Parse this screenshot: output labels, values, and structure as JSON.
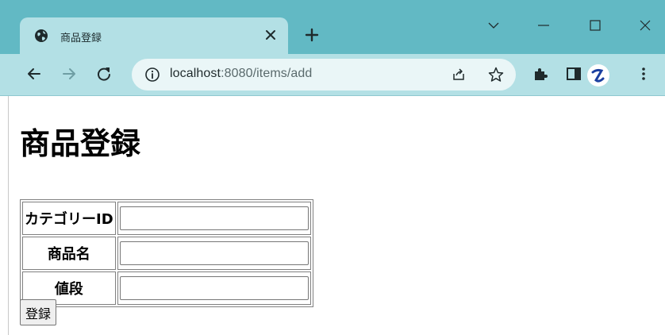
{
  "browser": {
    "tab": {
      "title": "商品登録",
      "favicon": "globe-icon"
    },
    "omnibox": {
      "icon": "info-icon",
      "url_host": "localhost",
      "url_rest": ":8080/items/add"
    },
    "window_controls": [
      "chevron-down-icon",
      "minimize-icon",
      "maximize-icon",
      "close-icon"
    ],
    "toolbar_icons": [
      "back-arrow-icon",
      "forward-arrow-icon",
      "reload-icon",
      "share-icon",
      "star-icon",
      "extensions-icon",
      "side-panel-icon",
      "profile-avatar",
      "menu-icon"
    ],
    "colors": {
      "tabstrip": "#62b9c4",
      "active_tab": "#b3e0e5",
      "omnibox": "#eaf6f7"
    }
  },
  "page": {
    "title": "商品登録",
    "form": {
      "rows": [
        {
          "label": "カテゴリーID",
          "value": ""
        },
        {
          "label": "商品名",
          "value": ""
        },
        {
          "label": "値段",
          "value": ""
        }
      ],
      "submit_label": "登録"
    }
  }
}
